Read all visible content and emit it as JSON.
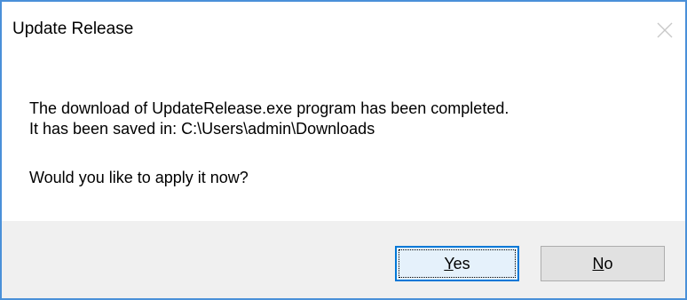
{
  "window": {
    "title": "Update Release"
  },
  "message": {
    "line1": "The download of UpdateRelease.exe program has been completed.",
    "line2": "It has been saved in: C:\\Users\\admin\\Downloads",
    "line3": "Would you like to apply it now?"
  },
  "buttons": {
    "yes": {
      "mnemonic": "Y",
      "rest": "es"
    },
    "no": {
      "mnemonic": "N",
      "rest": "o"
    }
  },
  "icons": {
    "close": "close-icon"
  },
  "colors": {
    "window_border": "#4a90d9",
    "footer_background": "#f0f0f0",
    "default_button_border": "#0078d7"
  }
}
